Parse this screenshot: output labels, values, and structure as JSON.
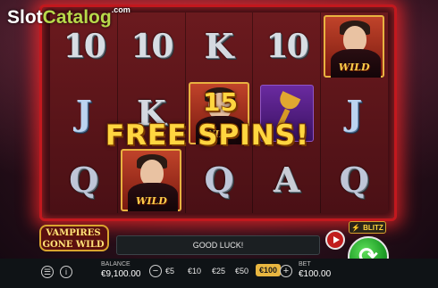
{
  "watermark": {
    "part1": "Slot",
    "part2": "Catalog",
    "sup": ".com"
  },
  "reels": [
    [
      "10",
      "10",
      "K",
      "10",
      "WILD"
    ],
    [
      "J",
      "K",
      "WILD",
      "CHALICE",
      "J"
    ],
    [
      "Q",
      "WILD",
      "Q",
      "A",
      "Q"
    ]
  ],
  "wild_label": "WILD",
  "overlay": {
    "count": "15",
    "text": "FREE SPINS!"
  },
  "logo": {
    "line1": "VAMPIRES",
    "line2": "GONE WILD"
  },
  "message": "GOOD LUCK!",
  "blitz_label": "BLITZ",
  "balance": {
    "label": "BALANCE",
    "value": "€9,100.00"
  },
  "bet_chips": [
    "€5",
    "€10",
    "€25",
    "€50",
    "€100"
  ],
  "selected_chip": "€100",
  "bet": {
    "label": "BET",
    "value": "€100.00"
  },
  "icons": {
    "menu": "☰",
    "info": "i",
    "minus": "−",
    "plus": "+",
    "spin": "⟳"
  },
  "colors": {
    "accent_gold": "#ffd640",
    "frame_red": "#c2181e",
    "spin_green": "#1e9c27"
  }
}
